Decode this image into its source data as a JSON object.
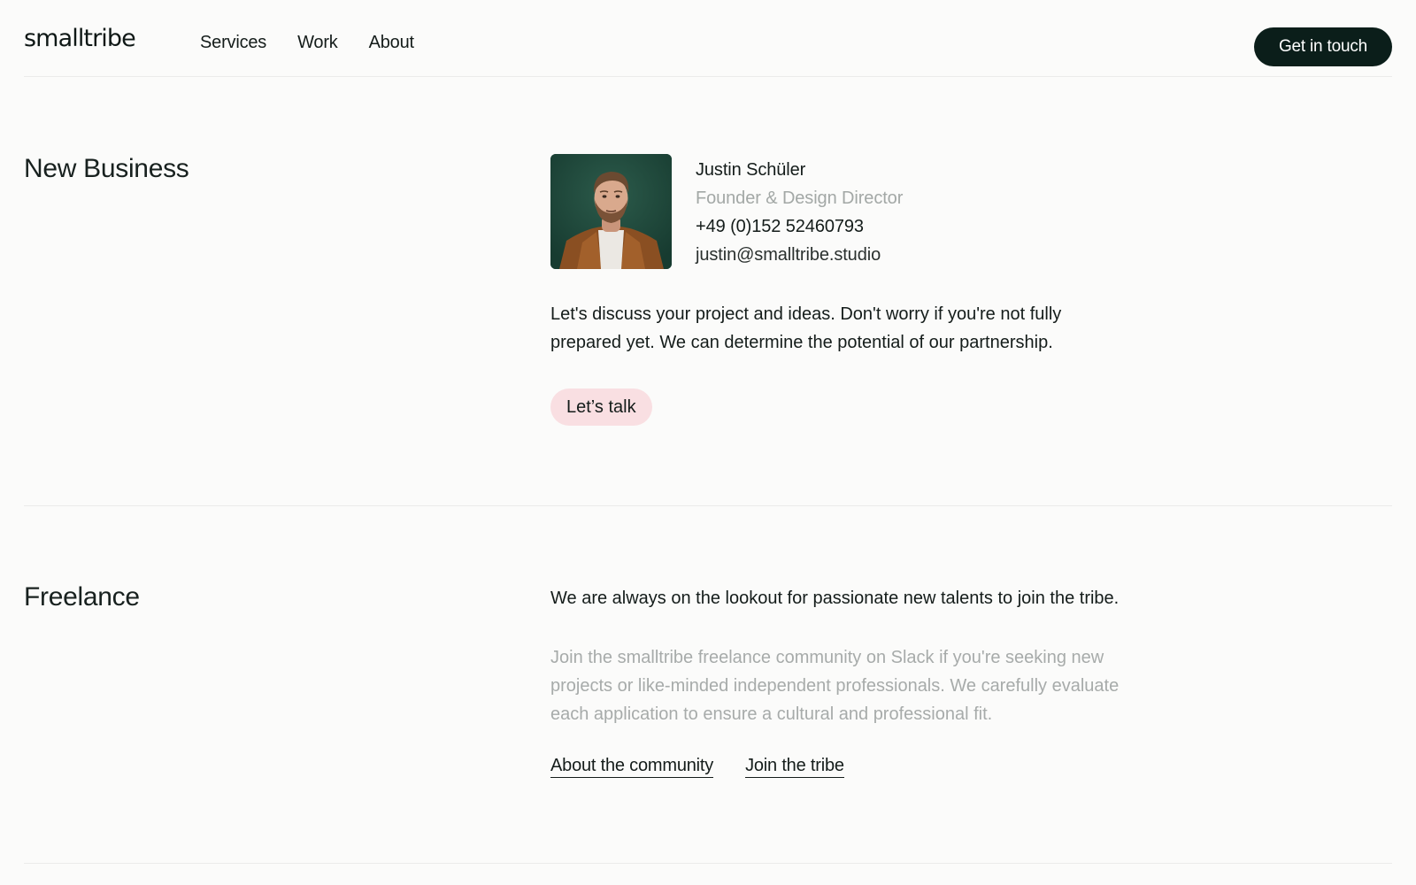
{
  "header": {
    "logo": "smalltribe",
    "nav": [
      "Services",
      "Work",
      "About"
    ],
    "cta": "Get in touch"
  },
  "new_business": {
    "title": "New Business",
    "contact": {
      "name": "Justin Schüler",
      "role": "Founder & Design Director",
      "phone": "+49 (0)152 52460793",
      "email": "justin@smalltribe.studio",
      "photo_alt": "Portrait of Justin Schüler"
    },
    "intro": "Let's discuss your project and ideas. Don't worry if you're not fully prepared yet. We can determine the potential of our partnership.",
    "button": "Let’s talk"
  },
  "freelance": {
    "title": "Freelance",
    "lead": "We are always on the lookout for passionate new talents to join the tribe.",
    "body": "Join the smalltribe freelance community on Slack if you're seeking new projects or like-minded independent professionals. We carefully evaluate each application to ensure a cultural and professional fit.",
    "links": [
      "About the community",
      "Join the tribe"
    ]
  },
  "colors": {
    "background": "#fbfbfa",
    "cta_dark": "#0b1e1a",
    "pill_pink": "#f9dfe2",
    "muted_text": "#a7abaa"
  }
}
